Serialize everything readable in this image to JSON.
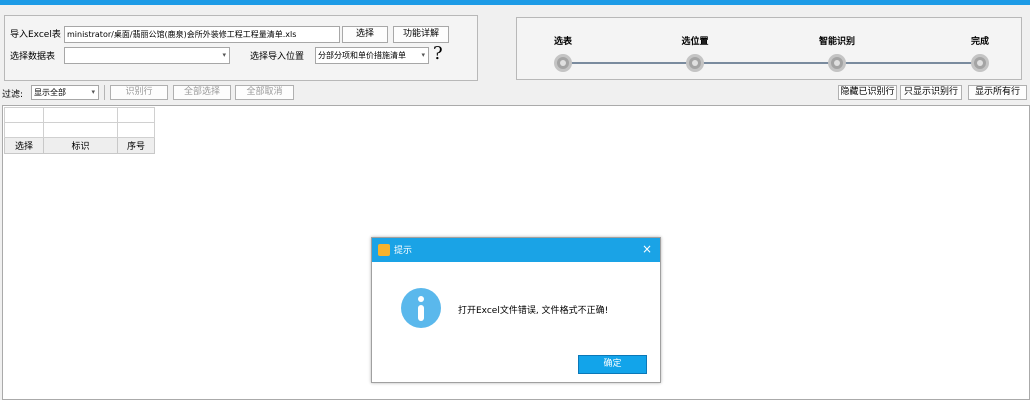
{
  "import_panel": {
    "excel_label": "导入Excel表",
    "excel_path": "ministrator/桌面/翡丽公馆(鹿泉)会所外装修工程工程量清单.xls",
    "select_button": "选择",
    "detail_button": "功能详解",
    "sheet_label": "选择数据表",
    "sheet_value": "",
    "position_label": "选择导入位置",
    "position_value": "分部分项和单价措施清单",
    "help_symbol": "?"
  },
  "steps": [
    "选表",
    "选位置",
    "智能识别",
    "完成"
  ],
  "filter": {
    "label": "过滤:",
    "select_value": "显示全部",
    "identify_row": "识别行",
    "select_all": "全部选择",
    "cancel_all": "全部取消",
    "hide_identified": "隐藏已识别行",
    "only_identified": "只显示识别行",
    "show_all_rows": "显示所有行"
  },
  "grid": {
    "columns": [
      "选择",
      "标识",
      "序号"
    ]
  },
  "dialog": {
    "title": "提示",
    "close": "×",
    "message": "打开Excel文件错误, 文件格式不正确!",
    "ok_button": "确定"
  },
  "colors": {
    "accent": "#1d9be6",
    "dialog_title": "#1aa3e6",
    "info_icon": "#5ab8ec",
    "ok_button": "#12a4ea"
  }
}
